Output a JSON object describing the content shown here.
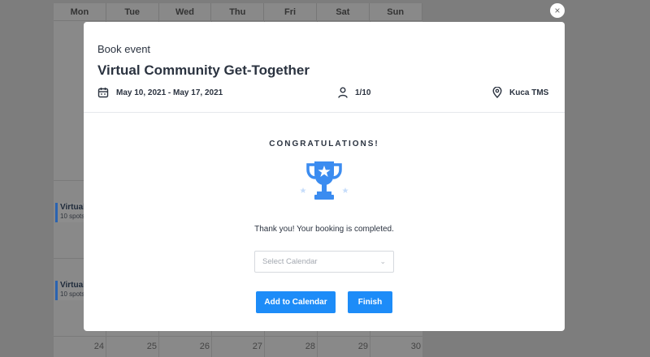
{
  "calendar": {
    "days": [
      "Mon",
      "Tue",
      "Wed",
      "Thu",
      "Fri",
      "Sat",
      "Sun"
    ],
    "events": [
      {
        "title": "Virtual",
        "spots": "10 spots"
      },
      {
        "title": "Virtual",
        "spots": "10 spots"
      }
    ],
    "dates": [
      "24",
      "25",
      "26",
      "27",
      "28",
      "29",
      "30"
    ]
  },
  "modal": {
    "close_icon": "×",
    "subtitle": "Book event",
    "title": "Virtual Community Get-Together",
    "date_range": "May 10, 2021 - May 17, 2021",
    "spots": "1/10",
    "location": "Kuca TMS",
    "congrats": "CONGRATULATIONS!",
    "thanks": "Thank you! Your booking is completed.",
    "select_placeholder": "Select Calendar",
    "add_button": "Add to Calendar",
    "finish_button": "Finish"
  },
  "colors": {
    "accent": "#1d8cf8",
    "trophy": "#3b8cf0",
    "overlay": "#7d7d7d"
  }
}
